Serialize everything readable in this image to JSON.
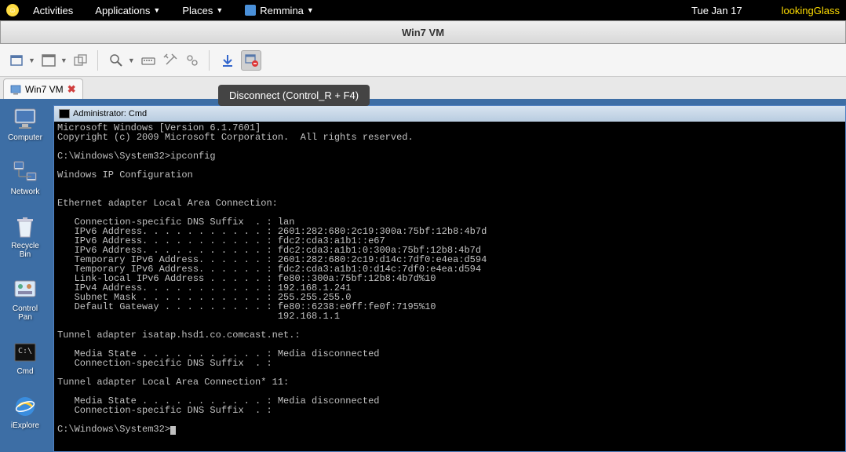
{
  "topbar": {
    "activities": "Activities",
    "applications": "Applications",
    "places": "Places",
    "remmina": "Remmina",
    "date": "Tue Jan 17",
    "user": "lookingGlass"
  },
  "window": {
    "title": "Win7 VM"
  },
  "tooltip": "Disconnect (Control_R + F4)",
  "tab": {
    "label": "Win7 VM"
  },
  "desktop_icons": [
    {
      "label": "Computer"
    },
    {
      "label": "Network"
    },
    {
      "label": "Recycle Bin"
    },
    {
      "label": "Control Pan"
    },
    {
      "label": "Cmd"
    },
    {
      "label": "iExplore"
    }
  ],
  "cmd": {
    "title": "Administrator: Cmd",
    "lines": [
      "Microsoft Windows [Version 6.1.7601]",
      "Copyright (c) 2009 Microsoft Corporation.  All rights reserved.",
      "",
      "C:\\Windows\\System32>ipconfig",
      "",
      "Windows IP Configuration",
      "",
      "",
      "Ethernet adapter Local Area Connection:",
      "",
      "   Connection-specific DNS Suffix  . : lan",
      "   IPv6 Address. . . . . . . . . . . : 2601:282:680:2c19:300a:75bf:12b8:4b7d",
      "   IPv6 Address. . . . . . . . . . . : fdc2:cda3:a1b1::e67",
      "   IPv6 Address. . . . . . . . . . . : fdc2:cda3:a1b1:0:300a:75bf:12b8:4b7d",
      "   Temporary IPv6 Address. . . . . . : 2601:282:680:2c19:d14c:7df0:e4ea:d594",
      "   Temporary IPv6 Address. . . . . . : fdc2:cda3:a1b1:0:d14c:7df0:e4ea:d594",
      "   Link-local IPv6 Address . . . . . : fe80::300a:75bf:12b8:4b7d%10",
      "   IPv4 Address. . . . . . . . . . . : 192.168.1.241",
      "   Subnet Mask . . . . . . . . . . . : 255.255.255.0",
      "   Default Gateway . . . . . . . . . : fe80::6238:e0ff:fe0f:7195%10",
      "                                       192.168.1.1",
      "",
      "Tunnel adapter isatap.hsd1.co.comcast.net.:",
      "",
      "   Media State . . . . . . . . . . . : Media disconnected",
      "   Connection-specific DNS Suffix  . :",
      "",
      "Tunnel adapter Local Area Connection* 11:",
      "",
      "   Media State . . . . . . . . . . . : Media disconnected",
      "   Connection-specific DNS Suffix  . :",
      "",
      "C:\\Windows\\System32>"
    ]
  }
}
